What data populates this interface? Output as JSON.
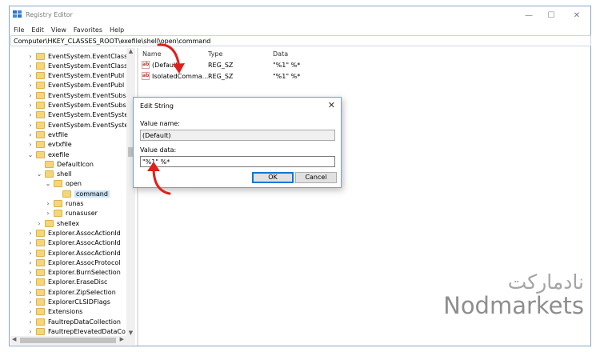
{
  "window": {
    "title": "Registry Editor",
    "controls": [
      "—",
      "☐",
      "✕"
    ]
  },
  "menu": [
    "File",
    "Edit",
    "View",
    "Favorites",
    "Help"
  ],
  "address": "Computer\\HKEY_CLASSES_ROOT\\exefile\\shell\\open\\command",
  "tree": [
    {
      "label": "EventSystem.EventClass",
      "indent": 0,
      "chevron": ">"
    },
    {
      "label": "EventSystem.EventClass",
      "indent": 0,
      "chevron": ">"
    },
    {
      "label": "EventSystem.EventPubl",
      "indent": 0,
      "chevron": ">"
    },
    {
      "label": "EventSystem.EventPubl",
      "indent": 0,
      "chevron": ">"
    },
    {
      "label": "EventSystem.EventSubs",
      "indent": 0,
      "chevron": ">"
    },
    {
      "label": "EventSystem.EventSubs",
      "indent": 0,
      "chevron": ">"
    },
    {
      "label": "EventSystem.EventSyste",
      "indent": 0,
      "chevron": ">"
    },
    {
      "label": "EventSystem.EventSyste",
      "indent": 0,
      "chevron": ">"
    },
    {
      "label": "evtfile",
      "indent": 0,
      "chevron": ">"
    },
    {
      "label": "evtxfile",
      "indent": 0,
      "chevron": ">"
    },
    {
      "label": "exefile",
      "indent": 0,
      "chevron": "v"
    },
    {
      "label": "DefaultIcon",
      "indent": 1,
      "chevron": ""
    },
    {
      "label": "shell",
      "indent": 1,
      "chevron": "v"
    },
    {
      "label": "open",
      "indent": 2,
      "chevron": "v"
    },
    {
      "label": "command",
      "indent": 3,
      "chevron": "",
      "selected": true
    },
    {
      "label": "runas",
      "indent": 2,
      "chevron": ">"
    },
    {
      "label": "runasuser",
      "indent": 2,
      "chevron": ">"
    },
    {
      "label": "shellex",
      "indent": 1,
      "chevron": ">"
    },
    {
      "label": "Explorer.AssocActionId",
      "indent": 0,
      "chevron": ">"
    },
    {
      "label": "Explorer.AssocActionId",
      "indent": 0,
      "chevron": ">"
    },
    {
      "label": "Explorer.AssocActionId",
      "indent": 0,
      "chevron": ">"
    },
    {
      "label": "Explorer.AssocProtocol",
      "indent": 0,
      "chevron": ">"
    },
    {
      "label": "Explorer.BurnSelection",
      "indent": 0,
      "chevron": ">"
    },
    {
      "label": "Explorer.EraseDisc",
      "indent": 0,
      "chevron": ">"
    },
    {
      "label": "Explorer.ZipSelection",
      "indent": 0,
      "chevron": ">"
    },
    {
      "label": "ExplorerCLSIDFlags",
      "indent": 0,
      "chevron": ">"
    },
    {
      "label": "Extensions",
      "indent": 0,
      "chevron": ">"
    },
    {
      "label": "FaultrepDataCollection",
      "indent": 0,
      "chevron": ">"
    },
    {
      "label": "FaultrepElevatedDataCo",
      "indent": 0,
      "chevron": ">"
    }
  ],
  "list": {
    "headers": {
      "name": "Name",
      "type": "Type",
      "data": "Data"
    },
    "rows": [
      {
        "name": "(Default)",
        "type": "REG_SZ",
        "data": "\"%1\" %*"
      },
      {
        "name": "IsolatedComma...",
        "type": "REG_SZ",
        "data": "\"%1\" %*"
      }
    ],
    "icon_text": "ab"
  },
  "dialog": {
    "title": "Edit String",
    "close": "✕",
    "value_name_label": "Value name:",
    "value_name": "(Default)",
    "value_data_label": "Value data:",
    "value_data": "\"%1\" %*",
    "ok": "OK",
    "cancel": "Cancel"
  },
  "watermark": {
    "persian": "نادمارکت",
    "english": "Nodmarkets"
  },
  "colors": {
    "annotation_arrow": "#e0201b",
    "selection": "#cce4f7",
    "folder": "#f5d67a",
    "ok_border": "#0078d7"
  }
}
